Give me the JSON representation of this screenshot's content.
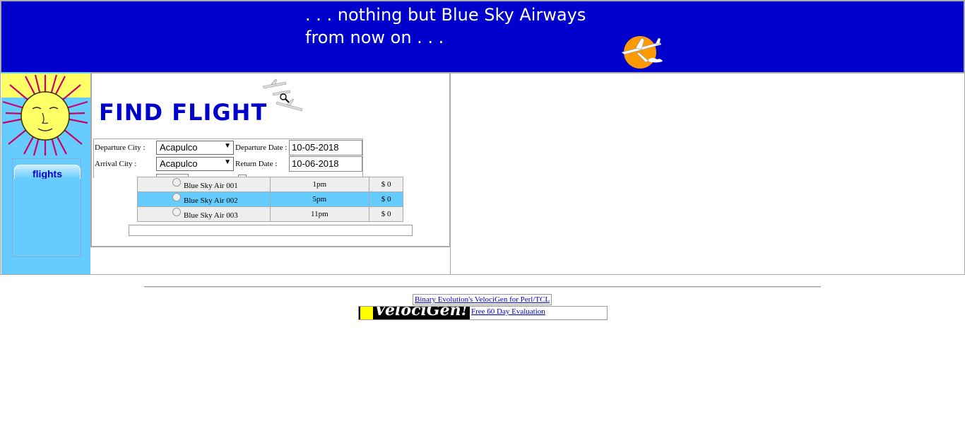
{
  "header": {
    "tagline_line1": ". . . nothing but Blue Sky Airways",
    "tagline_line2": "from now on . . ."
  },
  "sidebar": {
    "nav_items": [
      {
        "label": "flights"
      }
    ]
  },
  "content": {
    "title": "FIND FLIGHT",
    "form": {
      "departure_city_label": "Departure City :",
      "departure_city_value": "Acapulco",
      "arrival_city_label": "Arrival City :",
      "arrival_city_value": "Acapulco",
      "departure_date_label": "Departure Date :",
      "departure_date_value": "10-05-2018",
      "return_date_label": "Return Date :",
      "return_date_value": "10-06-2018"
    },
    "flights": [
      {
        "name": "Blue Sky Air 001",
        "time": "1pm",
        "price": "$ 0",
        "selected": false
      },
      {
        "name": "Blue Sky Air 002",
        "time": "5pm",
        "price": "$ 0",
        "selected": true
      },
      {
        "name": "Blue Sky Air 003",
        "time": "11pm",
        "price": "$ 0",
        "selected": false
      }
    ]
  },
  "footer": {
    "link1": "Binary Evolution's VelociGen for Perl/TCL",
    "logo_text": "VelociGen!",
    "link2": "Free 60 Day Evaluation"
  },
  "colors": {
    "header_bg": "#0000cc",
    "sidebar_bg": "#66ccff",
    "selected_row": "#66ccff",
    "title": "#0000cc"
  }
}
